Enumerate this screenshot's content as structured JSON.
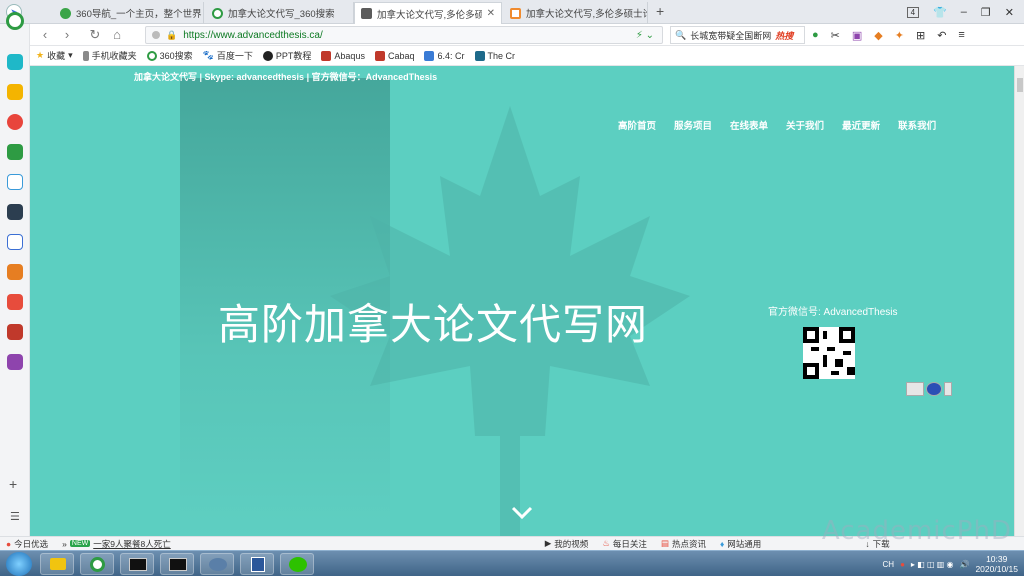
{
  "tabs": [
    {
      "title": "360导航_一个主页，整个世界",
      "color": "#3aa447",
      "active": false
    },
    {
      "title": "加拿大论文代写_360搜索",
      "color": "#2e9b43",
      "active": false
    },
    {
      "title": "加拿大论文代写,多伦多硕士论文",
      "color": "#5b5b5b",
      "active": true
    },
    {
      "title": "加拿大论文代写,多伦多硕士论文",
      "color": "#f08b2f",
      "active": false
    }
  ],
  "new_tab_label": "+",
  "window_controls": {
    "tab_count": "4",
    "minimize": "–",
    "maximize": "❐",
    "close": "✕"
  },
  "address_bar": {
    "url": "https://www.advancedthesis.ca/",
    "back": "‹",
    "forward": "›",
    "reload": "↻",
    "home": "⌂"
  },
  "search_box": {
    "text": "长城宽带疑全国断网",
    "hot": "热搜"
  },
  "bookmarks": [
    {
      "label": "收藏",
      "color": "#f1b21a"
    },
    {
      "label": "手机收藏夹",
      "color": "#8a8a8a"
    },
    {
      "label": "360搜索",
      "color": "#2e9b43"
    },
    {
      "label": "百度一下",
      "color": "#3b5bdb"
    },
    {
      "label": "PPT教程",
      "color": "#222"
    },
    {
      "label": "Abaqus",
      "color": "#c0392b"
    },
    {
      "label": "Cabaq",
      "color": "#c0392b"
    },
    {
      "label": "6.4: Cr",
      "color": "#3a7bd5"
    },
    {
      "label": "The Cr",
      "color": "#1e6a8a"
    }
  ],
  "page": {
    "top_tag": "加拿大论文代写 | Skype: advancedthesis | 官方微信号：AdvancedThesis",
    "nav": [
      "高阶首页",
      "服务项目",
      "在线表单",
      "关于我们",
      "最近更新",
      "联系我们"
    ],
    "hero_title": "高阶加拿大论文代写网",
    "wechat_label": "官方微信号: AdvancedThesis",
    "background_color": "#5ccfc1"
  },
  "statusbar": {
    "today": "今日优选",
    "new_badge": "NEW",
    "headline": "一家9人聚餐8人死亡",
    "right_items": [
      "我的视频",
      "每日关注",
      "热点资讯",
      "网站通用",
      "下载"
    ]
  },
  "watermark": "AcademicPhD",
  "taskbar": {
    "clock_time": "10:39",
    "clock_date": "2020/10/15",
    "lang": "CH"
  }
}
